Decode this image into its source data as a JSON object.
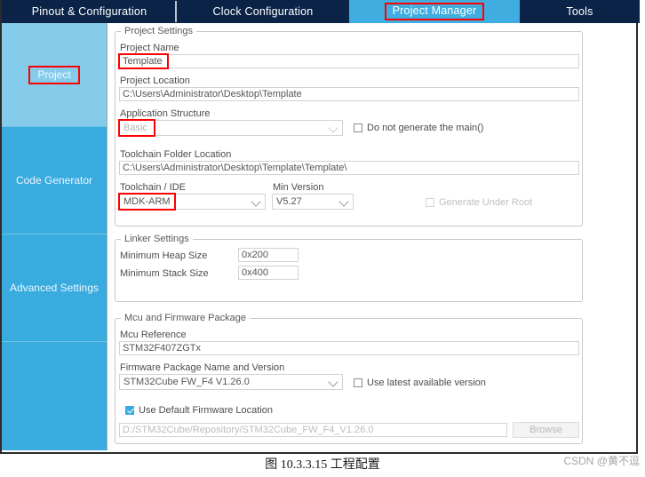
{
  "tabs": [
    {
      "label": "Pinout & Configuration",
      "active": false
    },
    {
      "label": "Clock Configuration",
      "active": false
    },
    {
      "label": "Project Manager",
      "active": true
    },
    {
      "label": "Tools",
      "active": false
    }
  ],
  "sidebar": {
    "items": [
      {
        "label": "Project",
        "selected": true
      },
      {
        "label": "Code Generator",
        "selected": false
      },
      {
        "label": "Advanced Settings",
        "selected": false
      }
    ]
  },
  "project_settings": {
    "legend": "Project Settings",
    "project_name_label": "Project Name",
    "project_name_value": "Template",
    "project_location_label": "Project Location",
    "project_location_value": "C:\\Users\\Administrator\\Desktop\\Template",
    "application_structure_label": "Application Structure",
    "application_structure_value": "Basic",
    "do_not_generate_main_label": "Do not generate the main()",
    "do_not_generate_main_checked": false,
    "toolchain_folder_label": "Toolchain Folder Location",
    "toolchain_folder_value": "C:\\Users\\Administrator\\Desktop\\Template\\Template\\",
    "toolchain_ide_label": "Toolchain / IDE",
    "toolchain_ide_value": "MDK-ARM",
    "min_version_label": "Min Version",
    "min_version_value": "V5.27",
    "generate_under_root_label": "Generate Under Root",
    "generate_under_root_checked": false
  },
  "linker_settings": {
    "legend": "Linker Settings",
    "min_heap_label": "Minimum Heap Size",
    "min_heap_value": "0x200",
    "min_stack_label": "Minimum Stack Size",
    "min_stack_value": "0x400"
  },
  "mcu_firmware": {
    "legend": "Mcu and Firmware Package",
    "mcu_reference_label": "Mcu Reference",
    "mcu_reference_value": "STM32F407ZGTx",
    "firmware_package_label": "Firmware Package Name and Version",
    "firmware_package_value": "STM32Cube FW_F4 V1.26.0",
    "use_latest_label": "Use latest available version",
    "use_latest_checked": false,
    "use_default_location_label": "Use Default Firmware Location",
    "use_default_location_checked": true,
    "firmware_path_value": "D:/STM32Cube/Repository/STM32Cube_FW_F4_V1.26.0",
    "browse_label": "Browse"
  },
  "caption": "图 10.3.3.15  工程配置",
  "watermark": "CSDN @黄不逗",
  "colors": {
    "tab_bar": "#0a2347",
    "tab_active": "#3fade0",
    "sidebar": "#3aabdf",
    "sidebar_selected": "#85cbea",
    "highlight": "#ff0000"
  }
}
